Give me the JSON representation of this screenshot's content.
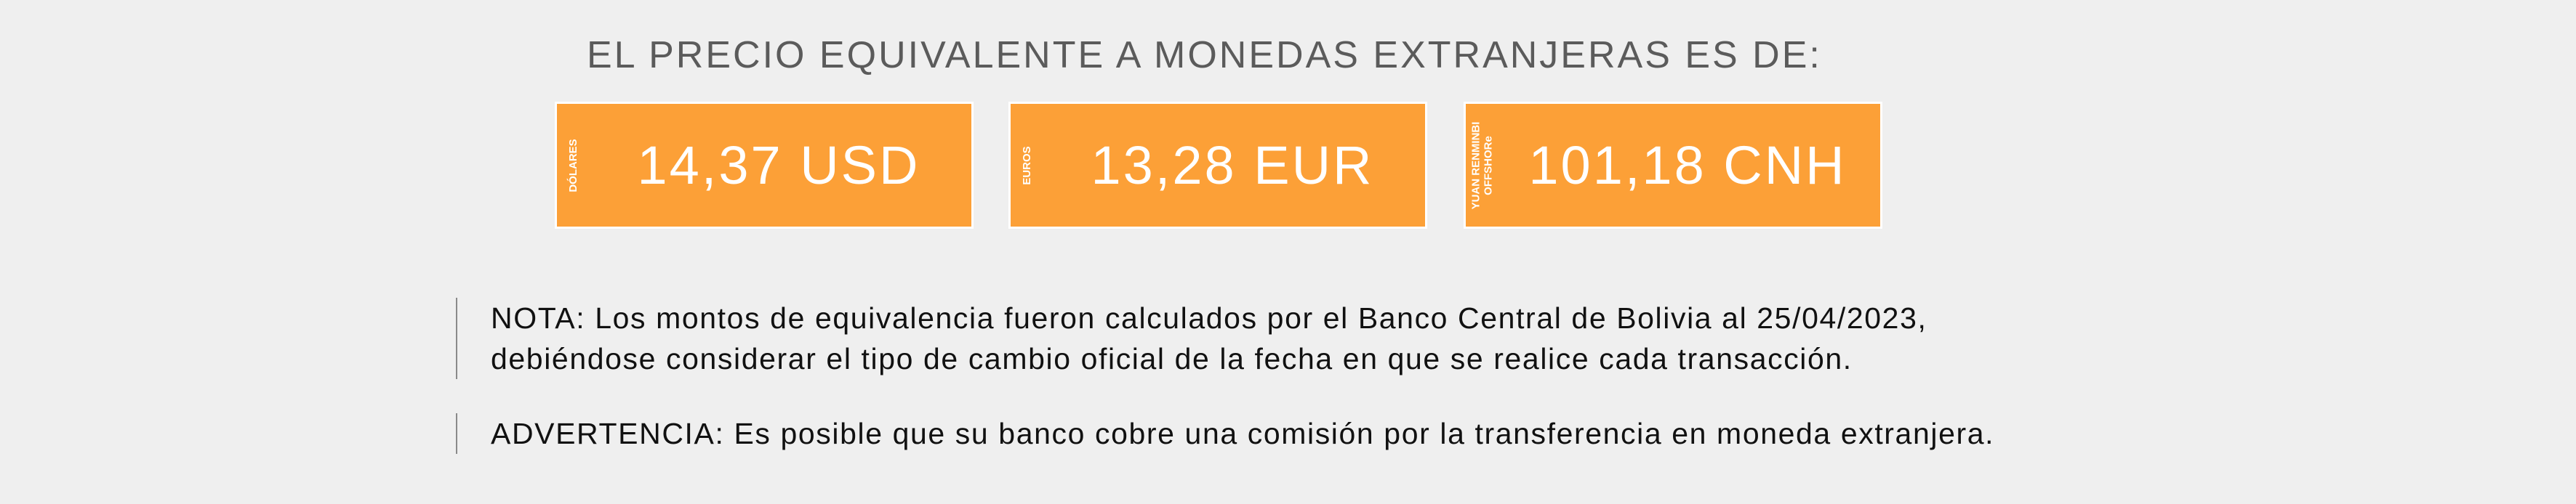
{
  "heading": "EL PRECIO EQUIVALENTE A MONEDAS EXTRANJERAS ES DE:",
  "cards": [
    {
      "label": "DÓLARES",
      "amount": "14,37 USD"
    },
    {
      "label": "EUROS",
      "amount": "13,28 EUR"
    },
    {
      "label": "YUAN RENMINBI\nOFFSHORe",
      "amount": "101,18 CNH"
    }
  ],
  "note": {
    "line1": "NOTA: Los montos de equivalencia fueron calculados por el Banco Central de Bolivia al 25/04/2023,",
    "line2": "debiéndose considerar el tipo de cambio oficial de la fecha en que se realice cada transacción."
  },
  "warning": "ADVERTENCIA: Es posible que su banco cobre una comisión por la transferencia en moneda extranjera.",
  "colors": {
    "card_background": "#fca037",
    "page_background": "#efefef",
    "heading_text": "#5b5b5b"
  }
}
